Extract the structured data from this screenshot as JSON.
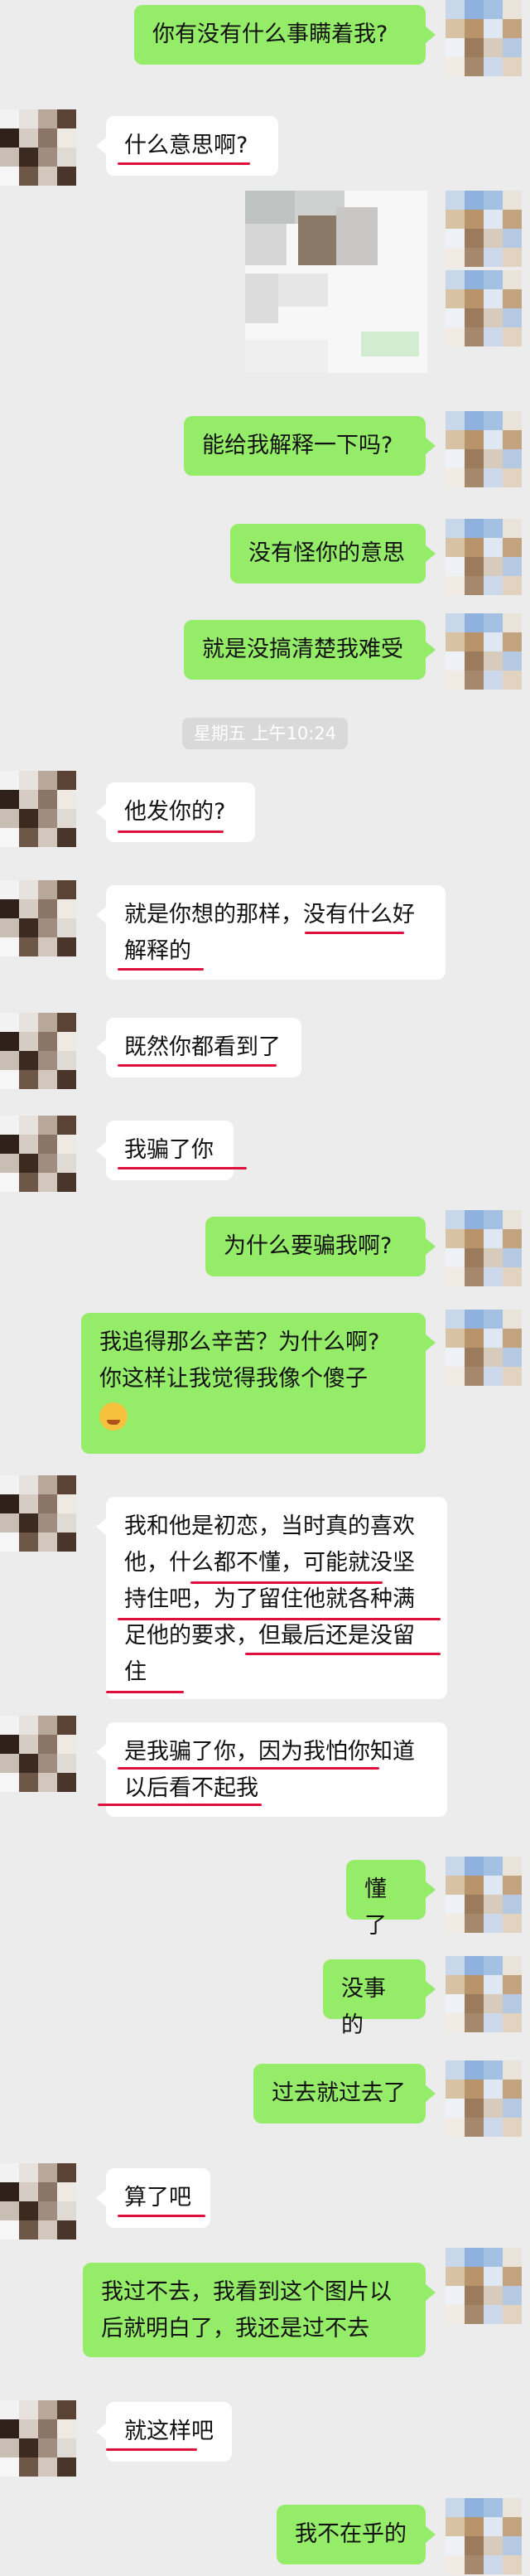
{
  "messages": [
    {
      "side": "out",
      "text": "你有没有什么事瞒着我?"
    },
    {
      "side": "in",
      "text": "什么意思啊?"
    },
    {
      "side": "out",
      "kind": "image"
    },
    {
      "side": "out",
      "text": "能给我解释一下吗?"
    },
    {
      "side": "out",
      "text": "没有怪你的意思"
    },
    {
      "side": "out",
      "text": "就是没搞清楚我难受"
    },
    {
      "kind": "timestamp",
      "text": "星期五 上午10:24"
    },
    {
      "side": "in",
      "text": "他发你的?"
    },
    {
      "side": "in",
      "line1": "就是你想的那样，没有什么好",
      "line2": "解释的"
    },
    {
      "side": "in",
      "text": "既然你都看到了"
    },
    {
      "side": "in",
      "text": "我骗了你"
    },
    {
      "side": "out",
      "text": "为什么要骗我啊?"
    },
    {
      "side": "out",
      "line1": "我追得那么辛苦？为什么啊?",
      "line2": "你这样让我觉得我像个傻子",
      "emoji": "grinning-sweat-emoji"
    },
    {
      "side": "in",
      "line1": "我和他是初恋，当时真的喜欢",
      "line2": "他，什么都不懂，可能就没坚",
      "line3": "持住吧，为了留住他就各种满",
      "line4": "足他的要求，但最后还是没留",
      "line5": "住"
    },
    {
      "side": "in",
      "line1": "是我骗了你，因为我怕你知道",
      "line2": "以后看不起我"
    },
    {
      "side": "out",
      "text": "懂了"
    },
    {
      "side": "out",
      "text": "没事的"
    },
    {
      "side": "out",
      "text": "过去就过去了"
    },
    {
      "side": "in",
      "text": "算了吧"
    },
    {
      "side": "out",
      "line1": "我过不去，我看到这个图片以",
      "line2": "后就明白了，我还是过不去"
    },
    {
      "side": "in",
      "text": "就这样吧"
    },
    {
      "side": "out",
      "text": "我不在乎的"
    }
  ],
  "colors": {
    "background": "#ececec",
    "incoming_bubble": "#ffffff",
    "outgoing_bubble": "#95ec69",
    "annotation_underline": "#e0103c"
  }
}
